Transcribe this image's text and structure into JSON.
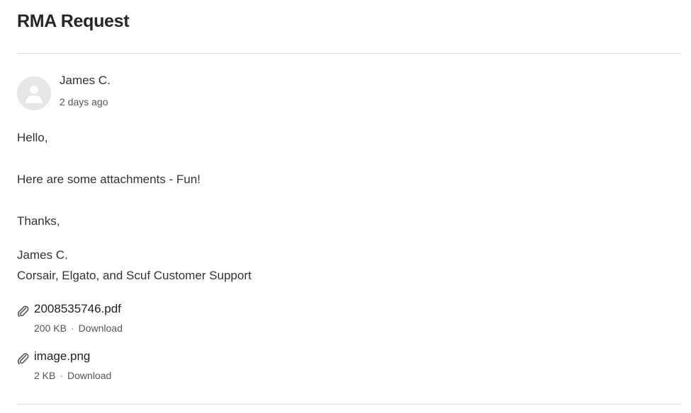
{
  "ticket": {
    "title": "RMA Request"
  },
  "comment": {
    "author": "James C.",
    "time": "2 days ago",
    "body": [
      "Hello,",
      "Here are some attachments - Fun!",
      "Thanks,",
      "James C.",
      "Corsair, Elgato, and Scuf Customer Support"
    ]
  },
  "attachments": [
    {
      "name": "2008535746.pdf",
      "size": "200 KB",
      "separator": "·",
      "action": "Download",
      "icon": "paperclip-icon"
    },
    {
      "name": "image.png",
      "size": "2 KB",
      "separator": "·",
      "action": "Download",
      "icon": "paperclip-icon"
    }
  ]
}
